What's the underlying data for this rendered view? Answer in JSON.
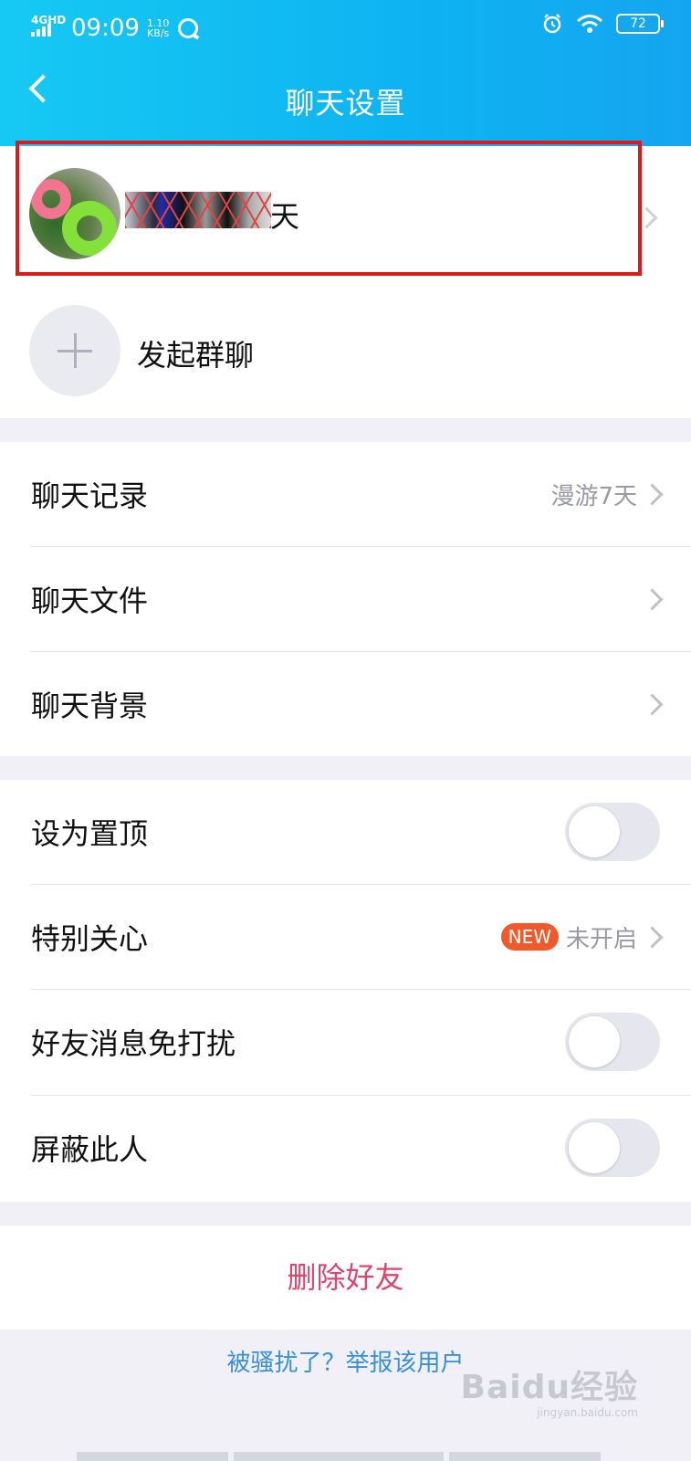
{
  "status_bar": {
    "network": "4GHD",
    "time": "09:09",
    "speed": "1.10",
    "speed_unit": "KB/s",
    "battery": "72"
  },
  "header": {
    "title": "聊天设置"
  },
  "contact": {
    "name_suffix": "天"
  },
  "group_chat": {
    "label": "发起群聊"
  },
  "section1": [
    {
      "label": "聊天记录",
      "value": "漫游7天"
    },
    {
      "label": "聊天文件"
    },
    {
      "label": "聊天背景"
    }
  ],
  "section2": [
    {
      "label": "设为置顶",
      "toggle": false
    },
    {
      "label": "特别关心",
      "badge": "NEW",
      "value": "未开启"
    },
    {
      "label": "好友消息免打扰",
      "toggle": false
    },
    {
      "label": "屏蔽此人",
      "toggle": false
    }
  ],
  "delete_button": "删除好友",
  "report_link": "被骚扰了？举报该用户",
  "watermark": {
    "brand": "Baidu经验",
    "url": "jingyan.baidu.com"
  },
  "colors": {
    "header_start": "#16c9f3",
    "header_end": "#14a5f0",
    "delete_text": "#e2456b",
    "link_text": "#3a8fd6",
    "badge_bg": "#f05a2b",
    "highlight_border": "#e01818"
  }
}
